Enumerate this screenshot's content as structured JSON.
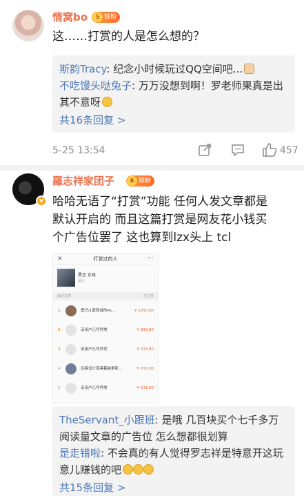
{
  "comments": [
    {
      "username": "情窝bo",
      "badge": {
        "level": "5",
        "label": "铁粉"
      },
      "text": "这……打赏的人是怎么想的？",
      "replies": [
        {
          "name": "斯韵Tracy",
          "text": ": 纪念小时候玩过QQ空间吧..."
        },
        {
          "name": "不吃馒头哒兔子",
          "text": ": 万万没想到啊！罗老师果真是出其不意呀"
        }
      ],
      "more_replies": "共16条回复 >",
      "time": "5-25 13:54",
      "likes": "457"
    },
    {
      "username": "羅志祥家团子",
      "badge": {
        "level": "6",
        "label": "铁粉"
      },
      "text_lines": [
        "哈哈无语了“打赏”功能 任何人发文章都是",
        "默认开启的 而且这篇打赏是网友花小钱买",
        "个广告位罢了 这也算到lzx头上 tcl"
      ],
      "embedded_screenshot": {
        "title": "打赏过的人",
        "author": "勇豆 女孩",
        "author_sub": "最近",
        "section_label": "最近打赏",
        "section_right": "已打赏",
        "rows": [
          {
            "rank": "1",
            "name": "塑巧/1家商城的Pa...",
            "amount": "¥ 1050.00"
          },
          {
            "rank": "2",
            "name": "该用户已号异常",
            "amount": "¥ 999.00"
          },
          {
            "rank": "3",
            "name": "该用户已号异常",
            "amount": "¥ 723.80"
          },
          {
            "rank": "4",
            "name": "动森设计道具着装更新...",
            "amount": "¥ 700.00"
          },
          {
            "rank": "5",
            "name": "该用户已号异常",
            "amount": "¥ 521.00"
          }
        ]
      },
      "replies": [
        {
          "name": "TheServant_小跟班",
          "text": ": 是哦 几百块买个七千多万阅读量文章的广告位 怎么想都很划算"
        },
        {
          "name": "是走错啦",
          "text": ": 不会真的有人觉得罗志祥是特意开这玩意儿赚钱的吧"
        }
      ],
      "more_replies": "共15条回复 >"
    }
  ]
}
